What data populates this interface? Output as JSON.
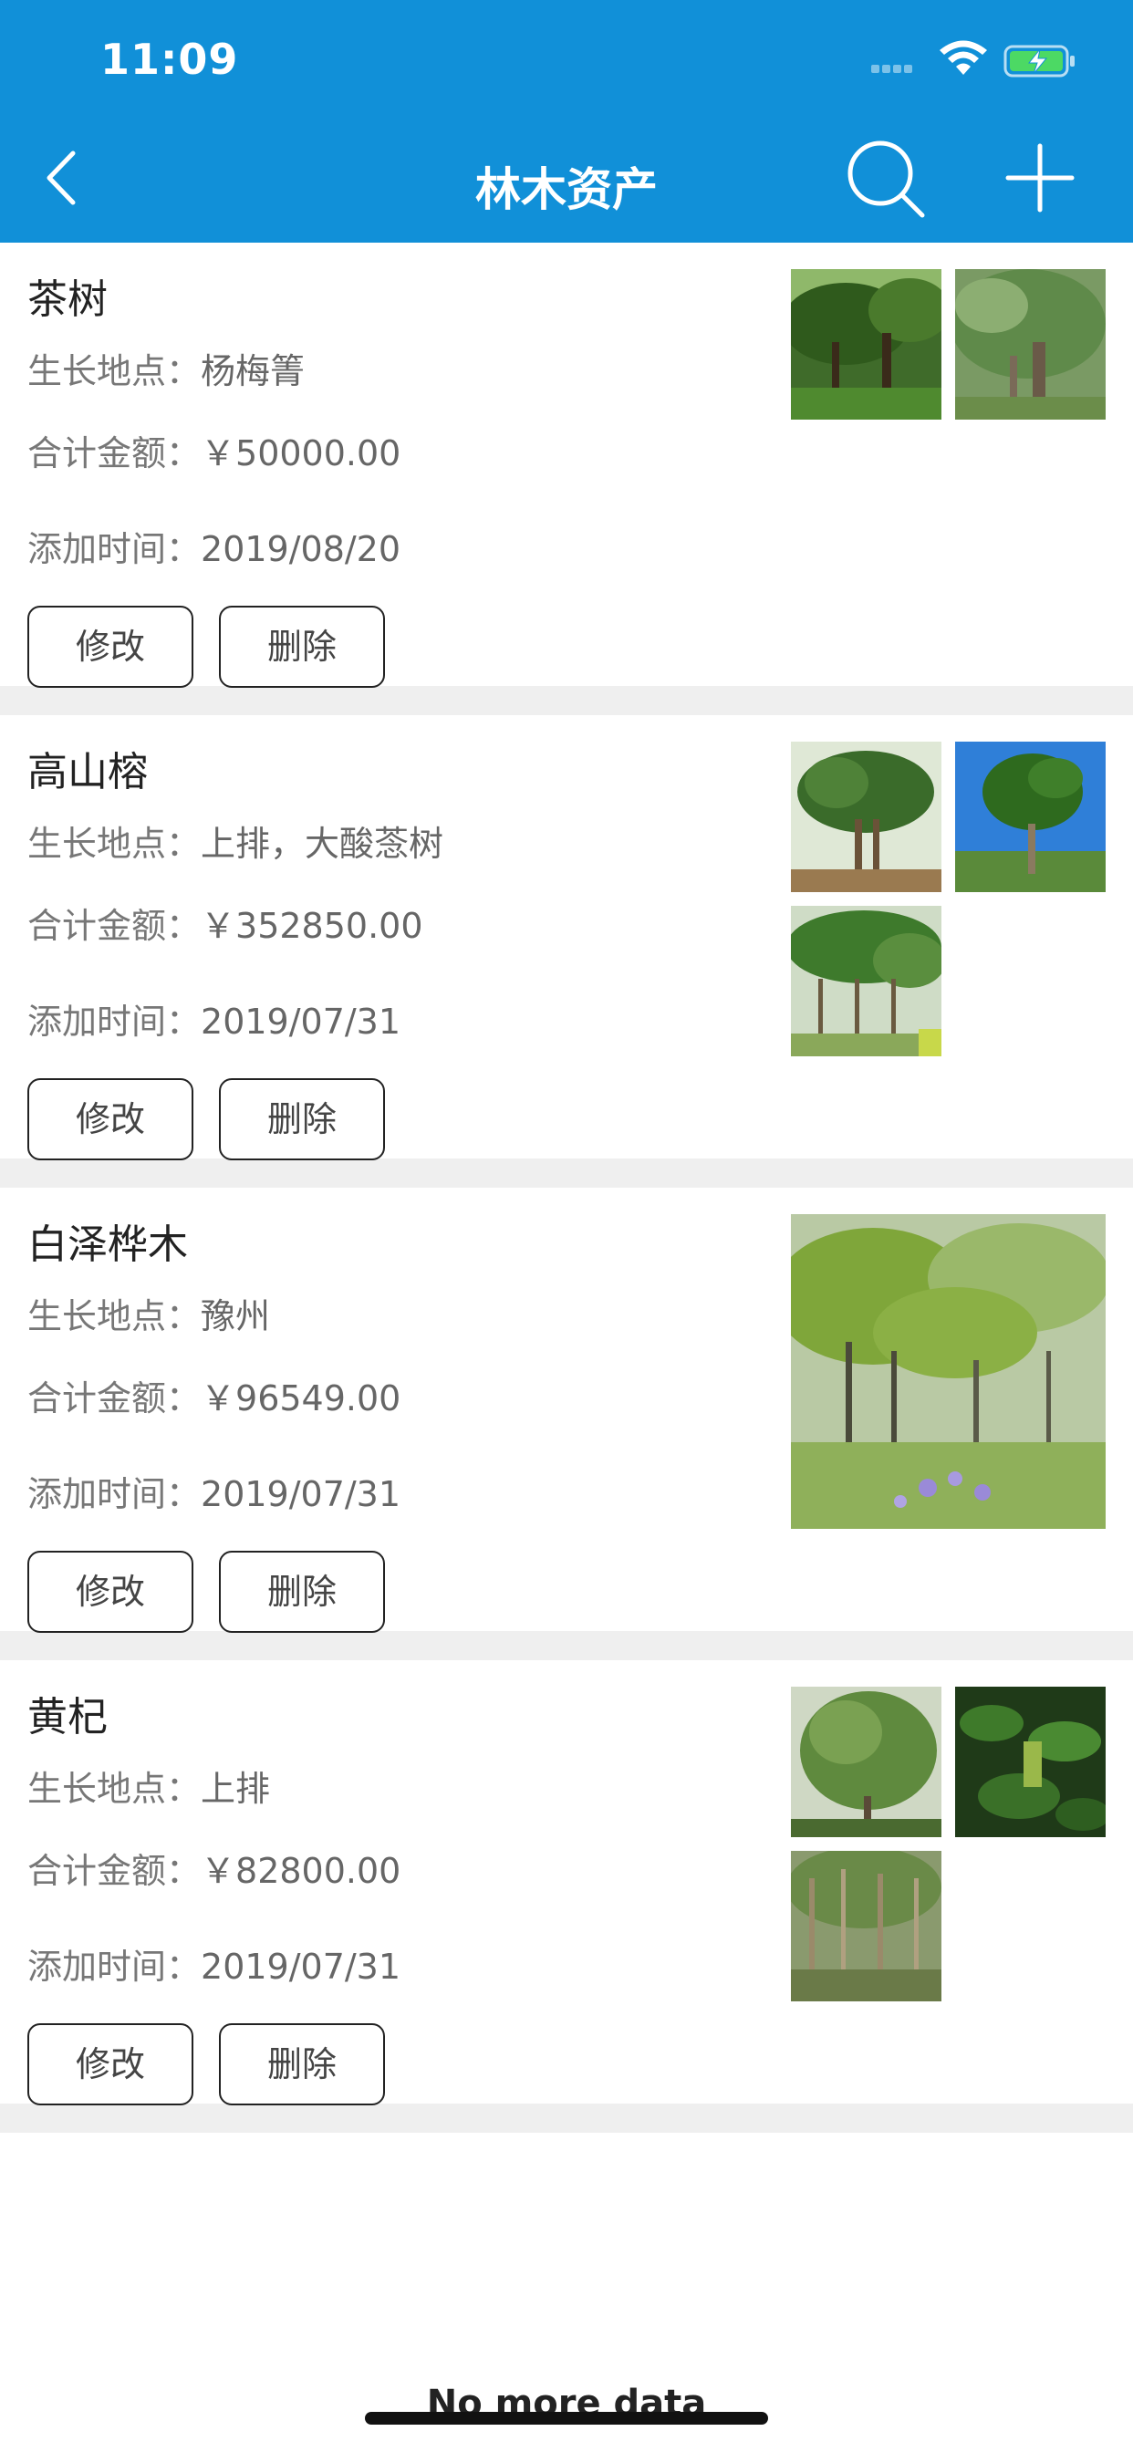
{
  "status_bar": {
    "time": "11:09"
  },
  "nav": {
    "title": "林木资产"
  },
  "labels": {
    "location": "生长地点：",
    "amount": "合计金额：",
    "date": "添加时间：",
    "edit_button": "修改",
    "delete_button": "删除"
  },
  "items": [
    {
      "name": "茶树",
      "location": "杨梅箐",
      "amount": "￥50000.00",
      "date": "2019/08/20",
      "photo_count": 2
    },
    {
      "name": "高山榕",
      "location": "上排，大酸菍树",
      "amount": "￥352850.00",
      "date": "2019/07/31",
      "photo_count": 3
    },
    {
      "name": "白泽桦木",
      "location": "豫州",
      "amount": "￥96549.00",
      "date": "2019/07/31",
      "photo_count": 1
    },
    {
      "name": "黄杞",
      "location": "上排",
      "amount": "￥82800.00",
      "date": "2019/07/31",
      "photo_count": 3
    }
  ],
  "footer": {
    "no_more": "No more data"
  },
  "colors": {
    "nav_bg": "#1190d8",
    "separator": "#efefef",
    "battery_fill": "#4cd964"
  }
}
